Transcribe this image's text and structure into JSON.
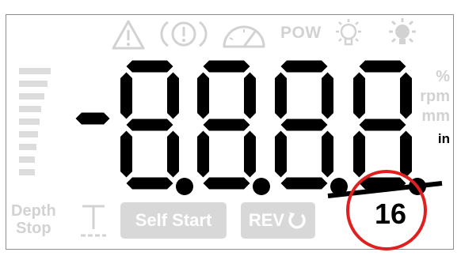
{
  "display": {
    "digits": [
      "-",
      "8.",
      "8.",
      "8.",
      "8."
    ],
    "segment_color": "#000000",
    "dim_color": "#d2d2d2",
    "accent_circle_color": "#e02020"
  },
  "indicators": {
    "warning_icon": "warning-triangle-icon",
    "alert_icon": "circle-exclamation-icon",
    "speed_icon": "speedometer-icon",
    "pow_label": "POW",
    "lamp_off_icon": "bulb-off-icon",
    "lamp_on_icon": "bulb-on-icon"
  },
  "units": {
    "percent": "%",
    "rpm": "rpm",
    "mm": "mm",
    "inch": "in",
    "active": "in"
  },
  "level_meter": {
    "segments": 9,
    "filled": 0
  },
  "depth_stop": {
    "line1": "Depth",
    "line2": "Stop"
  },
  "buttons": {
    "self_start": "Self Start",
    "reverse": "REV"
  },
  "fraction": {
    "denominator": "16"
  }
}
